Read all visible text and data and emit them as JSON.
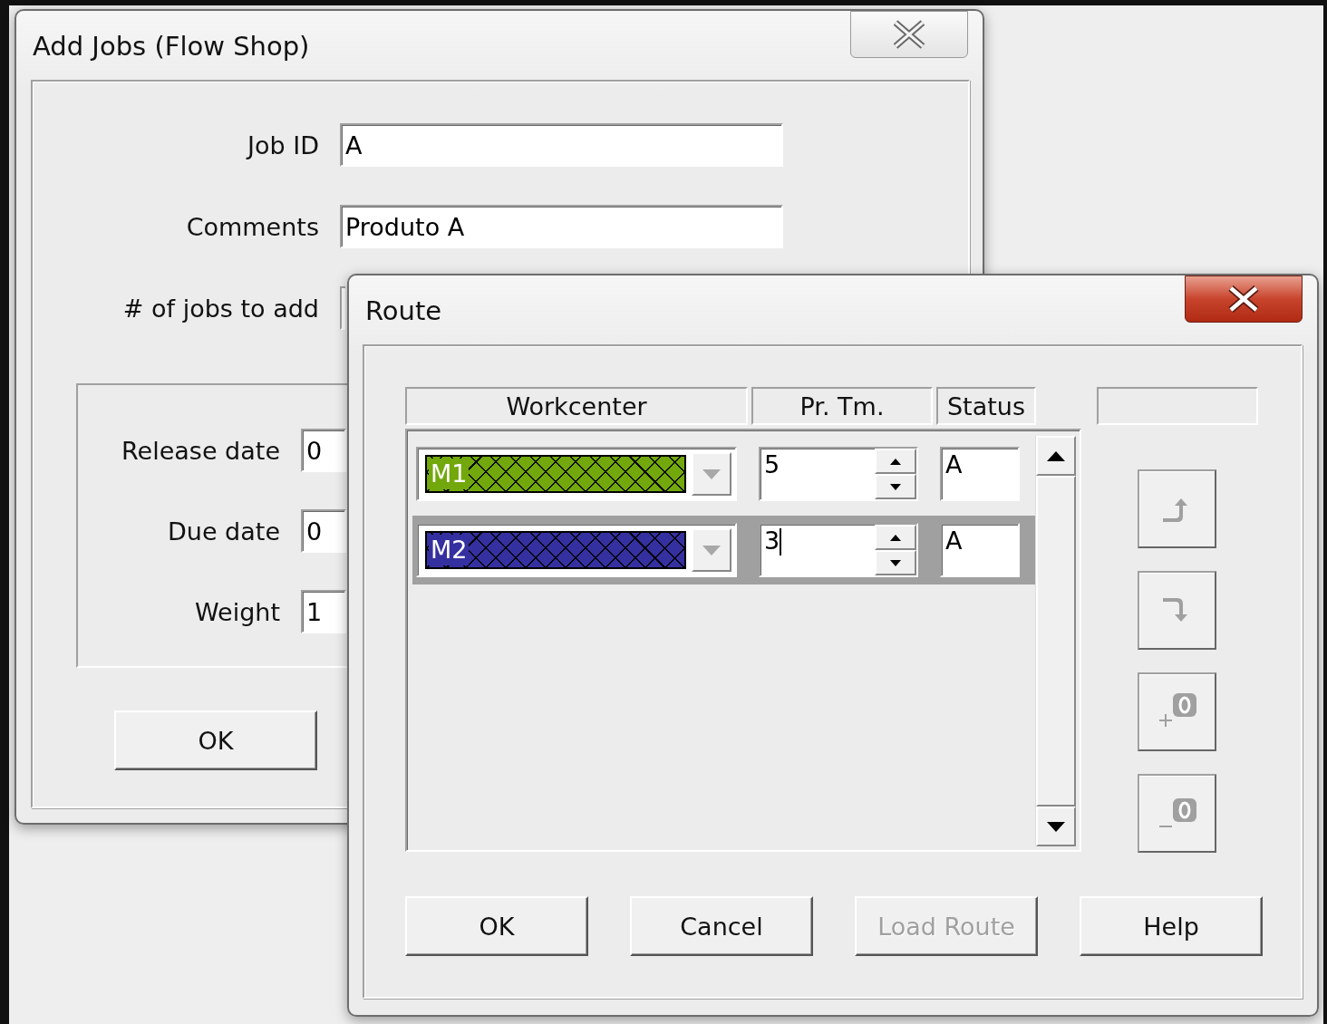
{
  "add_jobs": {
    "title": "Add Jobs (Flow Shop)",
    "fields": [
      {
        "label": "Job ID",
        "value": "A"
      },
      {
        "label": "Comments",
        "value": "Produto A"
      },
      {
        "label": "# of jobs to add"
      }
    ],
    "dates": [
      {
        "label": "Release date",
        "value": "0"
      },
      {
        "label": "Due date",
        "value": "0"
      },
      {
        "label": "Weight",
        "value": "1"
      }
    ],
    "ok": "OK"
  },
  "route": {
    "title": "Route",
    "columns": [
      "Workcenter",
      "Pr. Tm.",
      "Status"
    ],
    "rows": [
      {
        "workcenter": "M1",
        "color": "#72a80c",
        "pr_tm": "5",
        "status": "A",
        "selected": false
      },
      {
        "workcenter": "M2",
        "color": "#3530a0",
        "pr_tm": "3",
        "status": "A",
        "selected": true
      }
    ],
    "tools": [
      {
        "kind": "up",
        "disabled": true
      },
      {
        "kind": "down",
        "disabled": true
      },
      {
        "kind": "insert",
        "disabled": true
      },
      {
        "kind": "delete",
        "disabled": true
      }
    ],
    "buttons": [
      {
        "label": "OK",
        "disabled": false
      },
      {
        "label": "Cancel",
        "disabled": false
      },
      {
        "label": "Load Route",
        "disabled": true
      },
      {
        "label": "Help",
        "disabled": false
      }
    ]
  }
}
